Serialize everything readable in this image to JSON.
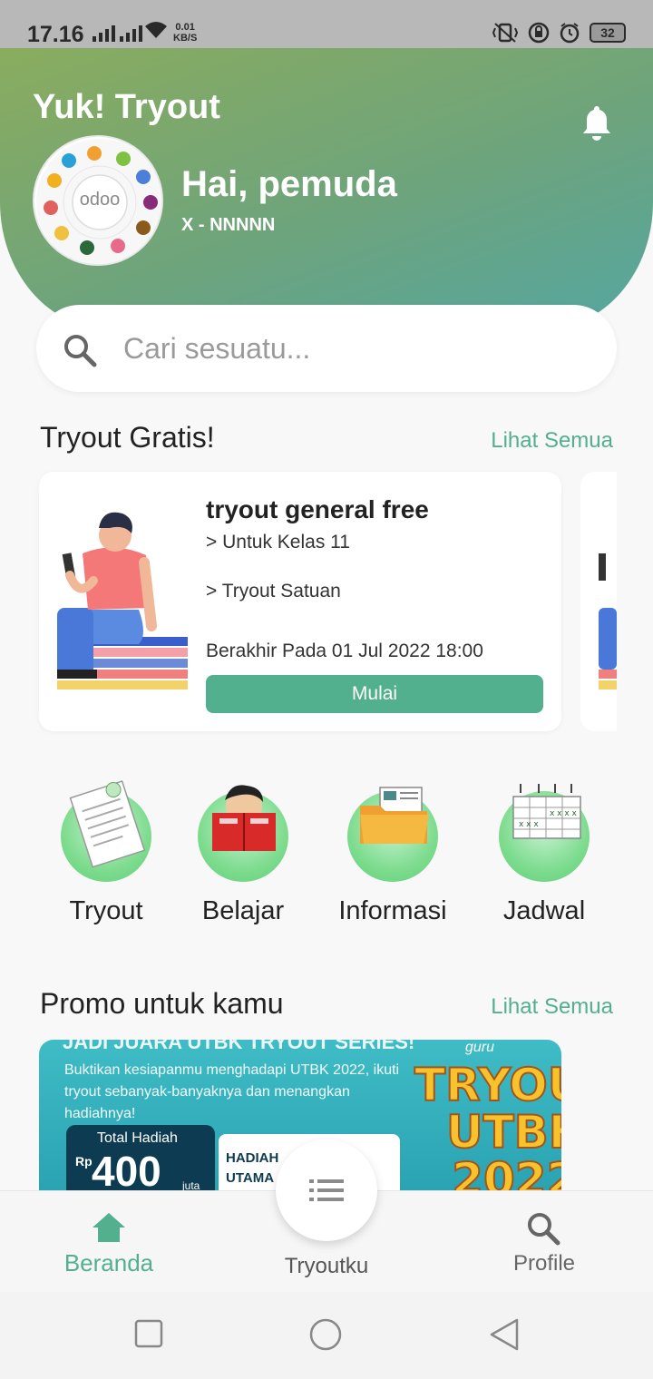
{
  "status_bar": {
    "time": "17.16",
    "net_speed_value": "0.01",
    "net_speed_unit": "KB/S",
    "battery": "32"
  },
  "header": {
    "app_title": "Yuk! Tryout",
    "greeting": "Hai, pemuda",
    "class_info": "X - NNNNN",
    "avatar_logo_text": "odoo"
  },
  "search": {
    "placeholder": "Cari sesuatu..."
  },
  "tryout_section": {
    "title": "Tryout Gratis!",
    "see_all": "Lihat Semua",
    "card": {
      "title": "tryout general free",
      "line1": "> Untuk Kelas 11",
      "line2": "> Tryout Satuan",
      "deadline": "Berakhir Pada 01 Jul 2022 18:00",
      "button": "Mulai"
    }
  },
  "menu": {
    "items": [
      {
        "label": "Tryout",
        "icon": "document-icon"
      },
      {
        "label": "Belajar",
        "icon": "reading-book-icon"
      },
      {
        "label": "Informasi",
        "icon": "folder-icon"
      },
      {
        "label": "Jadwal",
        "icon": "calendar-icon"
      }
    ]
  },
  "promo_section": {
    "title": "Promo untuk kamu",
    "see_all": "Lihat Semua",
    "banner": {
      "headline": "JADI JUARA UTBK TRYOUT SERIES!",
      "body": "Buktikan kesiapanmu menghadapi UTBK 2022, ikuti tryout sebanyak-banyaknya dan menangkan hadiahnya!",
      "prize_label": "Total Hadiah",
      "prize_currency": "Rp",
      "prize_amount": "400",
      "prize_unit": "juta",
      "hadiah_label": "HADIAH UTAMA",
      "big_title_line1": "TRYOUT",
      "big_title_line2": "UTBK",
      "big_title_line3": "2022",
      "brand": "guru"
    }
  },
  "bottom_nav": {
    "items": [
      {
        "label": "Beranda",
        "active": true
      },
      {
        "label": "Tryoutku",
        "active": false
      },
      {
        "label": "Profile",
        "active": false
      }
    ]
  },
  "colors": {
    "accent": "#52b08f",
    "header_start": "#8aac5e",
    "header_end": "#55a6a0"
  }
}
